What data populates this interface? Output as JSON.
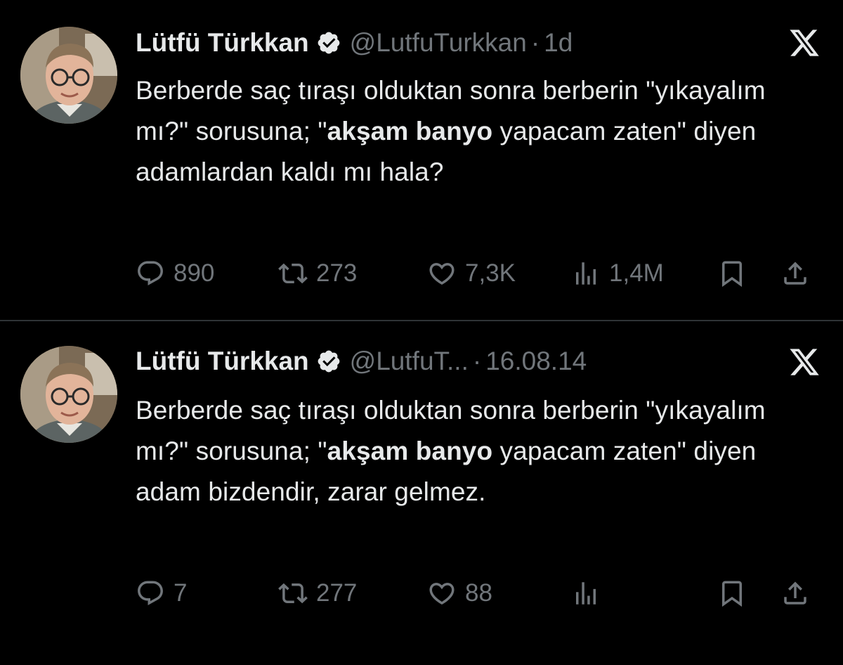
{
  "colors": {
    "background": "#000000",
    "text": "#e7e9ea",
    "secondary": "#71767b",
    "divider": "#2f3336"
  },
  "tweets": [
    {
      "author_name": "Lütfü Türkkan",
      "handle": "@LutfuTurkkan",
      "separator": "·",
      "time": "1d",
      "text_before_bold": "Berberde saç tıraşı olduktan sonra berberin \"yıkayalım mı?\" sorusuna; \"",
      "text_bold": "akşam banyo",
      "text_after_bold": " yapacam zaten\" diyen adamlardan kaldı mı hala?",
      "replies": "890",
      "reposts": "273",
      "likes": "7,3K",
      "views": "1,4M",
      "icons": [
        "verified-badge-icon",
        "x-logo-icon",
        "reply-icon",
        "repost-icon",
        "like-icon",
        "views-icon",
        "bookmark-icon",
        "share-icon"
      ]
    },
    {
      "author_name": "Lütfü Türkkan",
      "handle": "@LutfuT...",
      "separator": "·",
      "time": "16.08.14",
      "text_before_bold": "Berberde saç tıraşı olduktan sonra berberin \"yıkayalım mı?\" sorusuna; \"",
      "text_bold": "akşam banyo",
      "text_after_bold": " yapacam zaten\" diyen adam bizdendir, zarar gelmez.",
      "replies": "7",
      "reposts": "277",
      "likes": "88",
      "views": "",
      "icons": [
        "verified-badge-icon",
        "x-logo-icon",
        "reply-icon",
        "repost-icon",
        "like-icon",
        "views-icon",
        "bookmark-icon",
        "share-icon"
      ]
    }
  ]
}
